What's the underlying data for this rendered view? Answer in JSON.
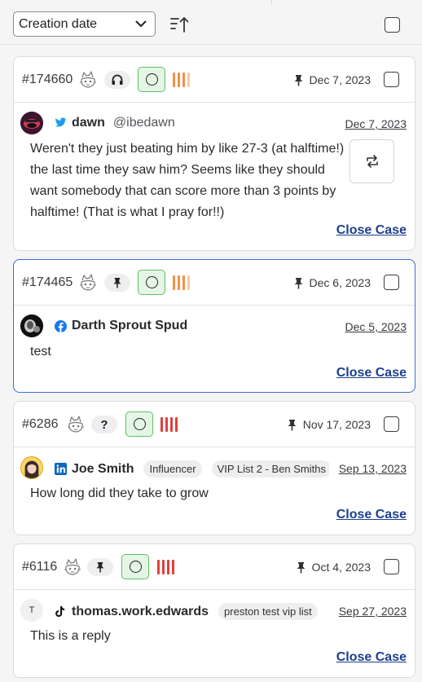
{
  "toolbar": {
    "sort_value": "Creation date",
    "sort_icon": "sort-ascending-icon"
  },
  "colors": {
    "status_green": "#5cc063",
    "priority_orange": "#f0924a",
    "priority_red": "#e0403a",
    "link_blue": "#1c3f8f",
    "selected_border": "#3b6fd6",
    "twitter": "#1d9bf0",
    "facebook": "#1877f2",
    "linkedin": "#0a66c2"
  },
  "cases": [
    {
      "id": "#174660",
      "assignee_icon": "headset-icon",
      "priority_level": "medium",
      "pinned_date": "Dec 7, 2023",
      "network": "twitter",
      "author_name": "dawn",
      "author_handle": "@ibedawn",
      "message_date": "Dec 7, 2023",
      "message": "Weren't they just beating him by like 27-3 (at halftime!) the last time they saw him? Seems like they should want somebody that can score more than 3 points by halftime! (That is what I pray for!!)",
      "close_label": "Close Case"
    },
    {
      "id": "#174465",
      "assignee_icon": "pin-icon",
      "priority_level": "medium",
      "pinned_date": "Dec 6, 2023",
      "network": "facebook",
      "author_name": "Darth Sprout Spud",
      "message_date": "Dec 5, 2023",
      "message": "test",
      "close_label": "Close Case"
    },
    {
      "id": "#6286",
      "assignee_label": "?",
      "priority_level": "high",
      "pinned_date": "Nov 17, 2023",
      "network": "linkedin",
      "author_name": "Joe Smith",
      "tags": [
        "Influencer",
        "VIP List 2 - Ben Smiths"
      ],
      "message_date": "Sep 13, 2023",
      "message": "How long did they take to grow",
      "close_label": "Close Case"
    },
    {
      "id": "#6116",
      "assignee_icon": "pin-icon",
      "priority_level": "high",
      "pinned_date": "Oct 4, 2023",
      "network": "tiktok",
      "avatar_initial": "T",
      "author_name": "thomas.work.edwards",
      "tags": [
        "preston test vip list"
      ],
      "message_date": "Sep 27, 2023",
      "message": "This is a reply",
      "close_label": "Close Case"
    }
  ]
}
